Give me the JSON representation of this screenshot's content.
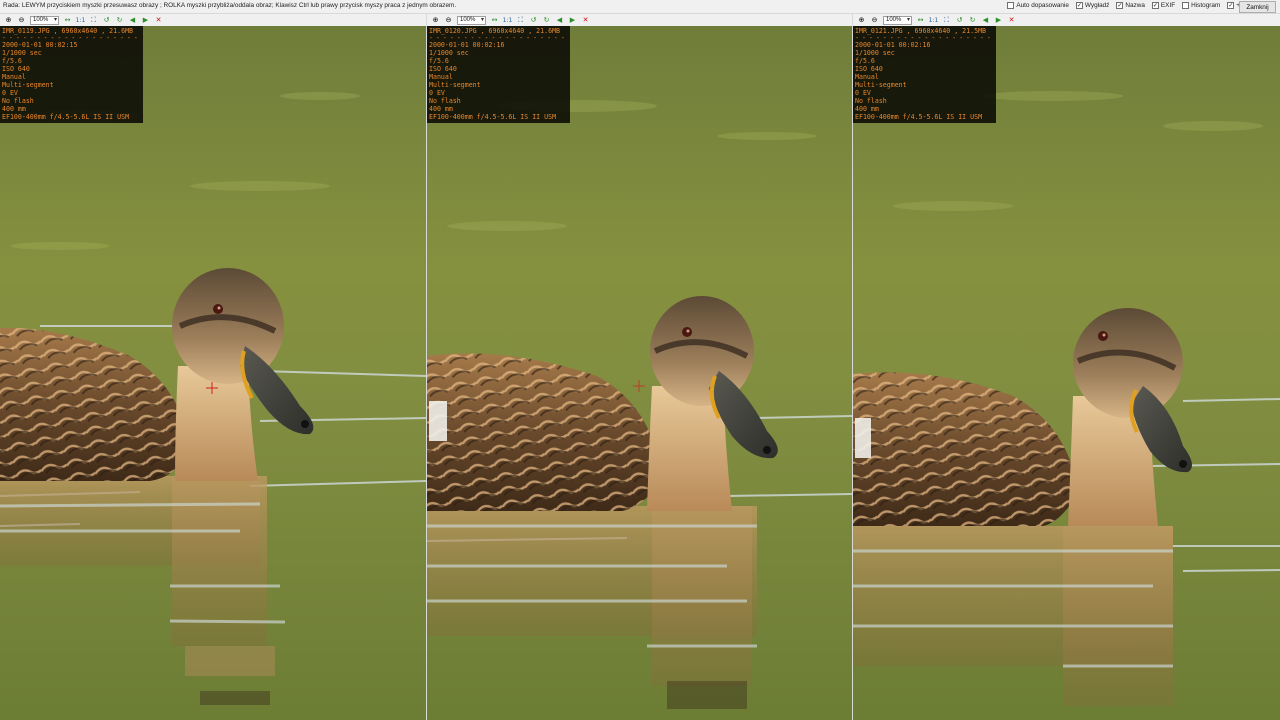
{
  "app": {
    "hint": "Rada: LEWYM przyciskiem myszki przesuwasz obrazy ; ROLKA myszki przybliża/oddala obraz; Klawisz Ctrl lub prawy przycisk myszy praca z jednym obrazem.",
    "options": [
      {
        "label": "Auto dopasowanie",
        "checked": false
      },
      {
        "label": "Wygładź",
        "checked": true
      },
      {
        "label": "Nazwa",
        "checked": true
      },
      {
        "label": "EXIF",
        "checked": true
      },
      {
        "label": "Histogram",
        "checked": false
      },
      {
        "label": "+",
        "checked": true
      }
    ],
    "close_label": "Zamknij"
  },
  "colors": {
    "exif_text": "#e8862a",
    "exif_bg": "#0a0a05",
    "water": "#7d8c43"
  },
  "toolbar_icons": [
    "zoom-in-icon",
    "zoom-out-icon",
    "zoom-select",
    "fit-icon",
    "actual-size-icon",
    "fullscreen-icon",
    "rotate-left-icon",
    "rotate-right-icon",
    "prev-icon",
    "next-icon",
    "close-image-icon"
  ],
  "panels": [
    {
      "zoom": "100%",
      "filename": "IMR_0119.JPG , 6960x4640 , 21.6MB",
      "datetime": "2000-01-01 00:02:15",
      "shutter": "1/1000 sec",
      "aperture": "f/5.6",
      "iso": "ISO 640",
      "mode": "Manual",
      "metering": "Multi-segment",
      "ev": "0 EV",
      "flash": "No flash",
      "focal": "400 mm",
      "lens": "EF100-400mm f/4.5-5.6L IS II USM"
    },
    {
      "zoom": "100%",
      "filename": "IMR_0120.JPG , 6960x4640 , 21.6MB",
      "datetime": "2000-01-01 00:02:16",
      "shutter": "1/1000 sec",
      "aperture": "f/5.6",
      "iso": "ISO 640",
      "mode": "Manual",
      "metering": "Multi-segment",
      "ev": "0 EV",
      "flash": "No flash",
      "focal": "400 mm",
      "lens": "EF100-400mm f/4.5-5.6L IS II USM"
    },
    {
      "zoom": "100%",
      "filename": "IMR_0121.JPG , 6960x4640 , 21.5MB",
      "datetime": "2000-01-01 00:02:16",
      "shutter": "1/1000 sec",
      "aperture": "f/5.6",
      "iso": "ISO 640",
      "mode": "Manual",
      "metering": "Multi-segment",
      "ev": "0 EV",
      "flash": "No flash",
      "focal": "400 mm",
      "lens": "EF100-400mm f/4.5-5.6L IS II USM"
    }
  ]
}
